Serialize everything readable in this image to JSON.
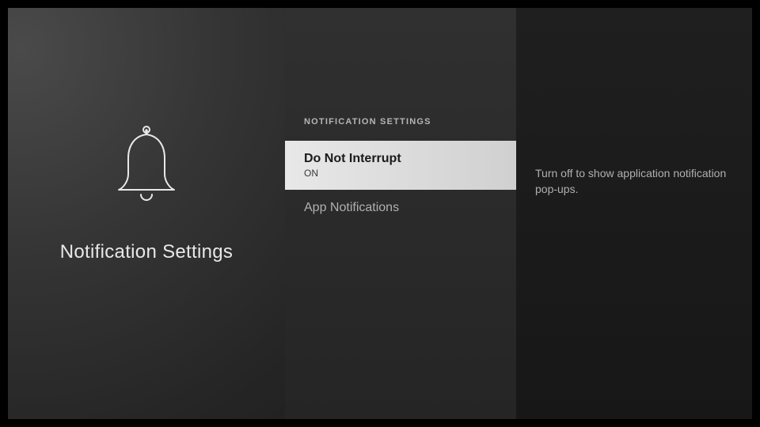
{
  "page": {
    "title": "Notification Settings",
    "section_header": "NOTIFICATION SETTINGS"
  },
  "menu": {
    "items": [
      {
        "title": "Do Not Interrupt",
        "subtitle": "ON",
        "selected": true
      },
      {
        "title": "App Notifications",
        "subtitle": "",
        "selected": false
      }
    ]
  },
  "description": {
    "text": "Turn off to show application notification pop-ups."
  }
}
